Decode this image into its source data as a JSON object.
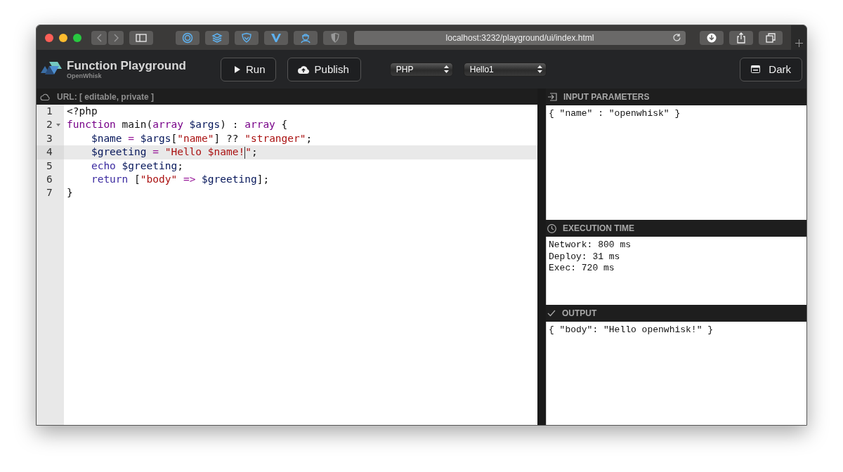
{
  "browser": {
    "url": "localhost:3232/playground/ui/index.html"
  },
  "app": {
    "title": "Function Playground",
    "subtitle": "OpenWhisk"
  },
  "actions": [
    {
      "kind": "run",
      "label": "Run"
    },
    {
      "kind": "publish",
      "label": "Publish"
    }
  ],
  "selects": [
    {
      "value": "PHP"
    },
    {
      "value": "Hello1"
    }
  ],
  "theme_button": {
    "kind": "theme",
    "label": "Dark"
  },
  "editor": {
    "url_label": "URL: [ editable, private ]",
    "lines": [
      {
        "number": "1",
        "active": false,
        "foldable": false,
        "tokens": [
          {
            "kind": "plain",
            "text": "<?php"
          }
        ]
      },
      {
        "number": "2",
        "active": false,
        "foldable": true,
        "tokens": [
          {
            "kind": "keyword",
            "text": "function"
          },
          {
            "kind": "plain",
            "text": " main("
          },
          {
            "kind": "keyword",
            "text": "array"
          },
          {
            "kind": "variable",
            "text": " $args"
          },
          {
            "kind": "plain",
            "text": ") : "
          },
          {
            "kind": "keyword",
            "text": "array"
          },
          {
            "kind": "plain",
            "text": " {"
          }
        ]
      },
      {
        "number": "3",
        "active": false,
        "foldable": false,
        "tokens": [
          {
            "kind": "variable",
            "text": "    $name"
          },
          {
            "kind": "operator",
            "text": " = "
          },
          {
            "kind": "variable",
            "text": "$args"
          },
          {
            "kind": "plain",
            "text": "["
          },
          {
            "kind": "string",
            "text": "\"name\""
          },
          {
            "kind": "plain",
            "text": "] ?? "
          },
          {
            "kind": "string",
            "text": "\"stranger\""
          },
          {
            "kind": "plain",
            "text": ";"
          }
        ]
      },
      {
        "number": "4",
        "active": true,
        "foldable": false,
        "tokens": [
          {
            "kind": "variable",
            "text": "    $greeting"
          },
          {
            "kind": "operator",
            "text": " = "
          },
          {
            "kind": "string",
            "text": "\"Hello $name!",
            "cursor_after": true
          },
          {
            "kind": "string",
            "text": "\""
          },
          {
            "kind": "plain",
            "text": ";"
          }
        ]
      },
      {
        "number": "5",
        "active": false,
        "foldable": false,
        "tokens": [
          {
            "kind": "keyword2",
            "text": "    echo"
          },
          {
            "kind": "variable",
            "text": " $greeting"
          },
          {
            "kind": "plain",
            "text": ";"
          }
        ]
      },
      {
        "number": "6",
        "active": false,
        "foldable": false,
        "tokens": [
          {
            "kind": "keyword2",
            "text": "    return"
          },
          {
            "kind": "plain",
            "text": " ["
          },
          {
            "kind": "string",
            "text": "\"body\""
          },
          {
            "kind": "operator",
            "text": " => "
          },
          {
            "kind": "variable",
            "text": "$greeting"
          },
          {
            "kind": "plain",
            "text": "];"
          }
        ]
      },
      {
        "number": "7",
        "active": false,
        "foldable": false,
        "tokens": [
          {
            "kind": "plain",
            "text": "}"
          }
        ]
      }
    ]
  },
  "panels": [
    {
      "kind": "input",
      "title": "INPUT PARAMETERS",
      "lines": [
        "{ \"name\" : \"openwhisk\" }"
      ]
    },
    {
      "kind": "time",
      "title": "EXECUTION TIME",
      "lines": [
        "Network: 800 ms",
        "Deploy: 31 ms",
        "Exec: 720 ms"
      ]
    },
    {
      "kind": "output",
      "title": "OUTPUT",
      "lines": [
        "{ \"body\": \"Hello openwhisk!\" }"
      ]
    }
  ]
}
